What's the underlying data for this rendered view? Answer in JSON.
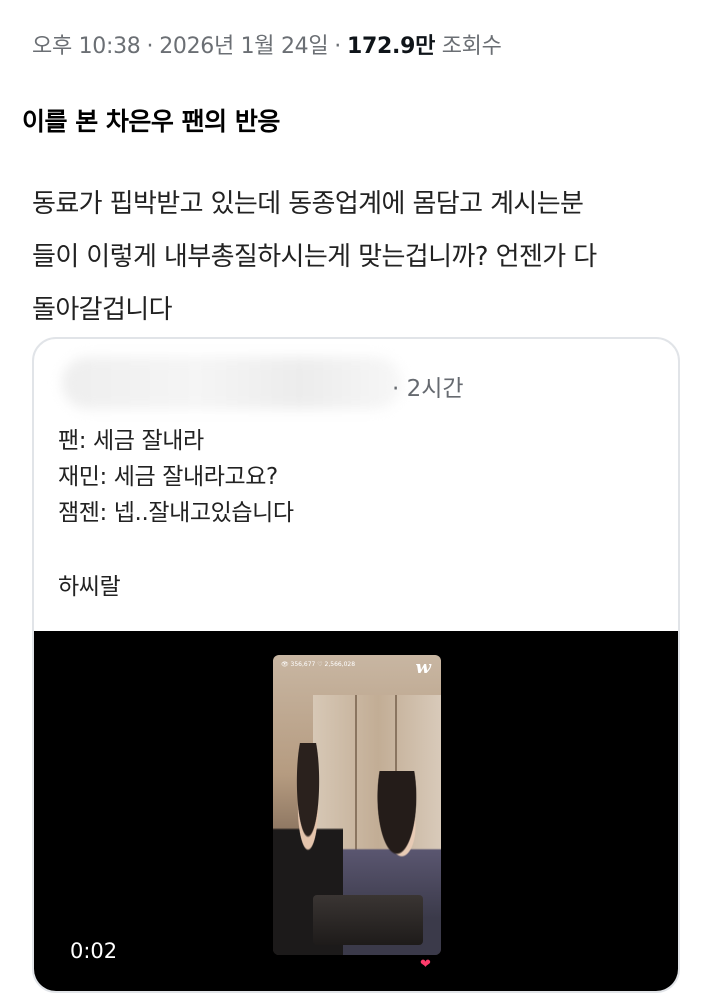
{
  "tweet_meta": {
    "time": "오후 10:38",
    "separator": "·",
    "date": "2026년 1월 24일",
    "views_count": "172.9만",
    "views_label": "조회수"
  },
  "heading": "이를 본 차은우 팬의 반응",
  "body_lines": [
    "동료가 핍박받고 있는데 동종업계에 몸담고 계시는분",
    "들이 이렇게 내부총질하시는게 맞는겁니까? 언젠가 다",
    "돌아갈겁니다"
  ],
  "quoted_post": {
    "timestamp": "· 2시간",
    "lines": [
      "팬: 세금 잘내라",
      "재민: 세금 잘내라고요?",
      "잼젠: 넵..잘내고있습니다",
      "하씨랄"
    ],
    "video": {
      "duration": "0:02",
      "overlay_stats": "👁 356,677  ♡ 2,566,028",
      "overlay_logo": "w",
      "heart_icon": "heart-icon"
    }
  }
}
